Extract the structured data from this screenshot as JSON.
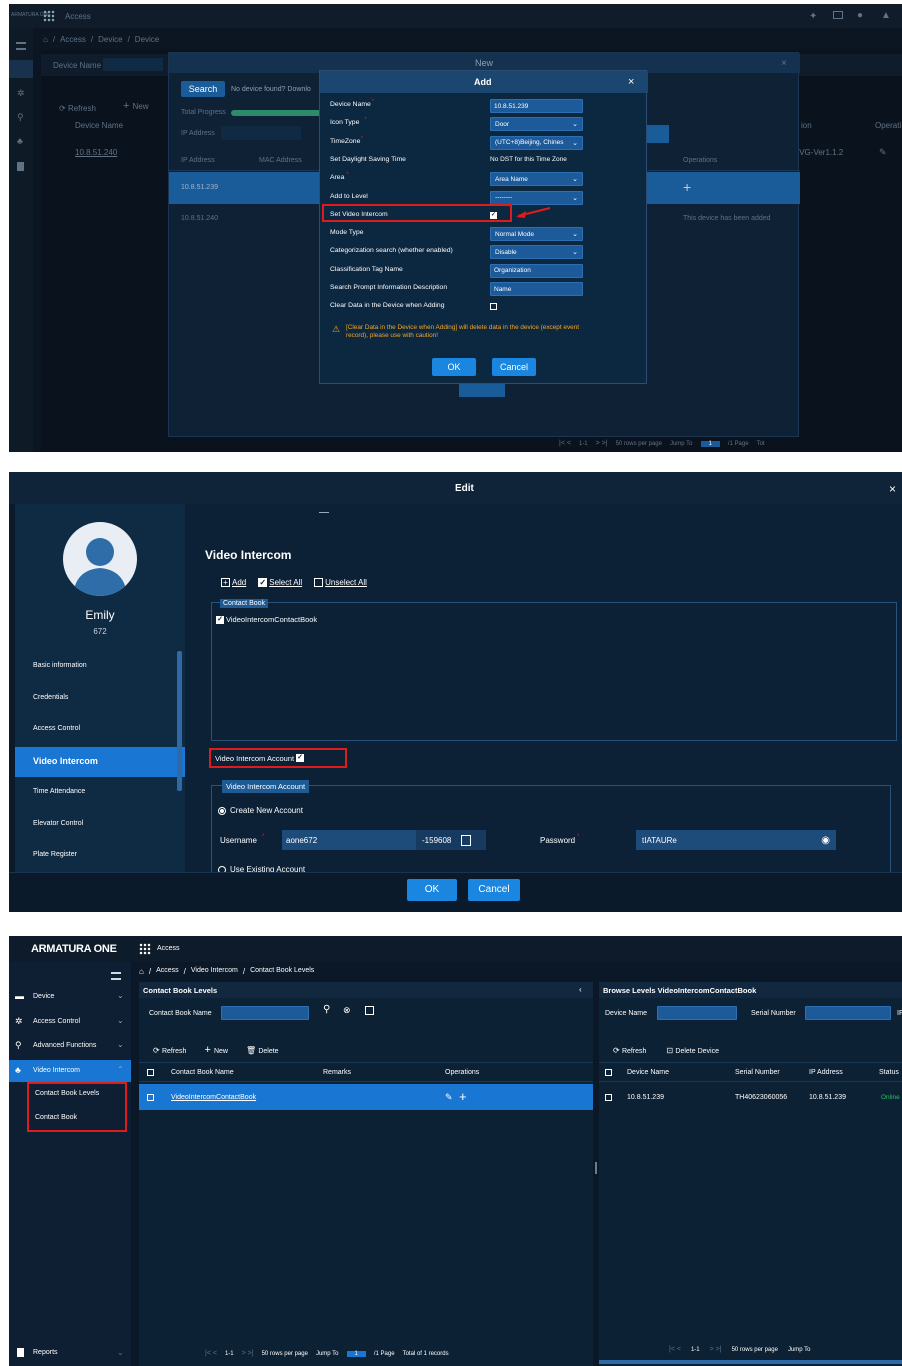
{
  "panel1": {
    "brand_small": "ARMATURA ONE",
    "app_title": "Access",
    "breadcrumb": [
      "Access",
      "/",
      "Device",
      "/",
      "Device"
    ],
    "device_name_label": "Device Name",
    "search_label": "Search",
    "no_device_text": "No device found? Downlo",
    "refresh_label": "Refresh",
    "new_label": "New",
    "total_progress_label": "Total Progress",
    "bg_ip_label": "IP Address",
    "bg_table_device_name": "Device Name",
    "bg_row_ip": "10.8.51.240",
    "bg_col_operations": "Operations",
    "bg_col_operati": "Operati",
    "bg_col_ion": "ion",
    "bg_version": "IVG-Ver1.1.2",
    "bg_ip_header": "IP Address",
    "bg_mac_header": "MAC Address",
    "bg_row1_ip": "10.8.51.239",
    "bg_row2_ip": "10.8.51.240",
    "bg_row2_status": "This device has been added",
    "pagination": {
      "range": "1-1",
      "rows": "50 rows per page",
      "jump": "Jump To",
      "page_num": "1",
      "of_page": "/1 Page",
      "tot": "Tot"
    },
    "dialog_new_title": "New",
    "dialog_add": {
      "title": "Add",
      "fields": [
        {
          "label": "Device Name",
          "required": true,
          "value": "10.8.51.239",
          "kind": "input"
        },
        {
          "label": "Icon Type",
          "required": true,
          "value": "Door",
          "kind": "select"
        },
        {
          "label": "TimeZone",
          "required": true,
          "value": "(UTC+8)Beijing, Chines",
          "kind": "select"
        },
        {
          "label": "Set Daylight Saving Time",
          "required": false,
          "value": "No DST for this Time Zone",
          "kind": "text"
        },
        {
          "label": "Area",
          "required": true,
          "value": "Area Name",
          "kind": "select"
        },
        {
          "label": "Add to Level",
          "required": false,
          "value": "--------",
          "kind": "select"
        },
        {
          "label": "Set Video Intercom",
          "required": false,
          "value": "",
          "kind": "checkbox-on"
        },
        {
          "label": "Mode Type",
          "required": false,
          "value": "Normal Mode",
          "kind": "select"
        },
        {
          "label": "Categorization search (whether enabled)",
          "required": false,
          "value": "Disable",
          "kind": "select"
        },
        {
          "label": "Classification Tag Name",
          "required": false,
          "value": "Organization",
          "kind": "input"
        },
        {
          "label": "Search Prompt Information Description",
          "required": false,
          "value": "Name",
          "kind": "input"
        },
        {
          "label": "Clear Data in the Device when Adding",
          "required": false,
          "value": "",
          "kind": "checkbox-off"
        }
      ],
      "warning_line1": "[Clear Data in the Device when Adding] will delete data in the device (except event",
      "warning_line2": "record), please use with caution!",
      "ok_label": "OK",
      "cancel_label": "Cancel"
    }
  },
  "panel2": {
    "title": "Edit",
    "user_name": "Emily",
    "user_id": "672",
    "nav": [
      "Basic information",
      "Credentials",
      "Access Control",
      "Video Intercom",
      "Time Attendance",
      "Elevator Control",
      "Plate Register"
    ],
    "section_title": "Video Intercom",
    "add_label": "Add",
    "select_all_label": "Select All",
    "unselect_all_label": "Unselect All",
    "contact_book_legend": "Contact Book",
    "contact_book_item": "VideoIntercomContactBook",
    "vi_account_checkbox_label": "Video Intercom Account",
    "vi_account_legend": "Video Intercom Account",
    "create_new_label": "Create New Account",
    "username_label": "Username",
    "username_value": "aone672",
    "username_suffix": "-159608",
    "password_label": "Password",
    "password_value": "tIATAURe",
    "use_existing_label": "Use Existing Account",
    "ok_label": "OK",
    "cancel_label": "Cancel"
  },
  "panel3": {
    "logo": "ARMATURA ONE",
    "app_title": "Access",
    "breadcrumb": [
      "Access",
      "/",
      "Video Intercom",
      "/",
      "Contact Book Levels"
    ],
    "sidebar": [
      {
        "label": "Device",
        "icon": "device-icon"
      },
      {
        "label": "Access Control",
        "icon": "gear-icon"
      },
      {
        "label": "Advanced Functions",
        "icon": "advanced-icon"
      },
      {
        "label": "Video Intercom",
        "icon": "intercom-icon"
      }
    ],
    "sub_items": [
      "Contact Book Levels",
      "Contact Book"
    ],
    "reports_label": "Reports",
    "left": {
      "title": "Contact Book Levels",
      "search_label": "Contact Book Name",
      "refresh_label": "Refresh",
      "new_label": "New",
      "delete_label": "Delete",
      "columns": [
        "Contact Book Name",
        "Remarks",
        "Operations"
      ],
      "rows": [
        {
          "name": "VideoIntercomContactBook",
          "remarks": ""
        }
      ],
      "pagination": {
        "range": "1-1",
        "rows": "50 rows per page",
        "jump": "Jump To",
        "page_num": "1",
        "of_page": "/1 Page",
        "total": "Total of 1 records"
      }
    },
    "right": {
      "title": "Browse Levels VideoIntercomContactBook",
      "device_name_label": "Device Name",
      "serial_label": "Serial Number",
      "ip_cut": "IF",
      "refresh_label": "Refresh",
      "delete_device_label": "Delete Device",
      "columns": [
        "Device Name",
        "Serial Number",
        "IP Address",
        "Status"
      ],
      "rows": [
        {
          "device": "10.8.51.239",
          "serial": "TH40623060056",
          "ip": "10.8.51.239",
          "status": "Online"
        }
      ],
      "pagination": {
        "range": "1-1",
        "rows": "50 rows per page",
        "jump": "Jump To"
      }
    }
  },
  "colors": {
    "accent": "#1a86e0",
    "highlight_red": "#e01b1b",
    "online": "#22c55e",
    "warning": "#f5a623"
  }
}
